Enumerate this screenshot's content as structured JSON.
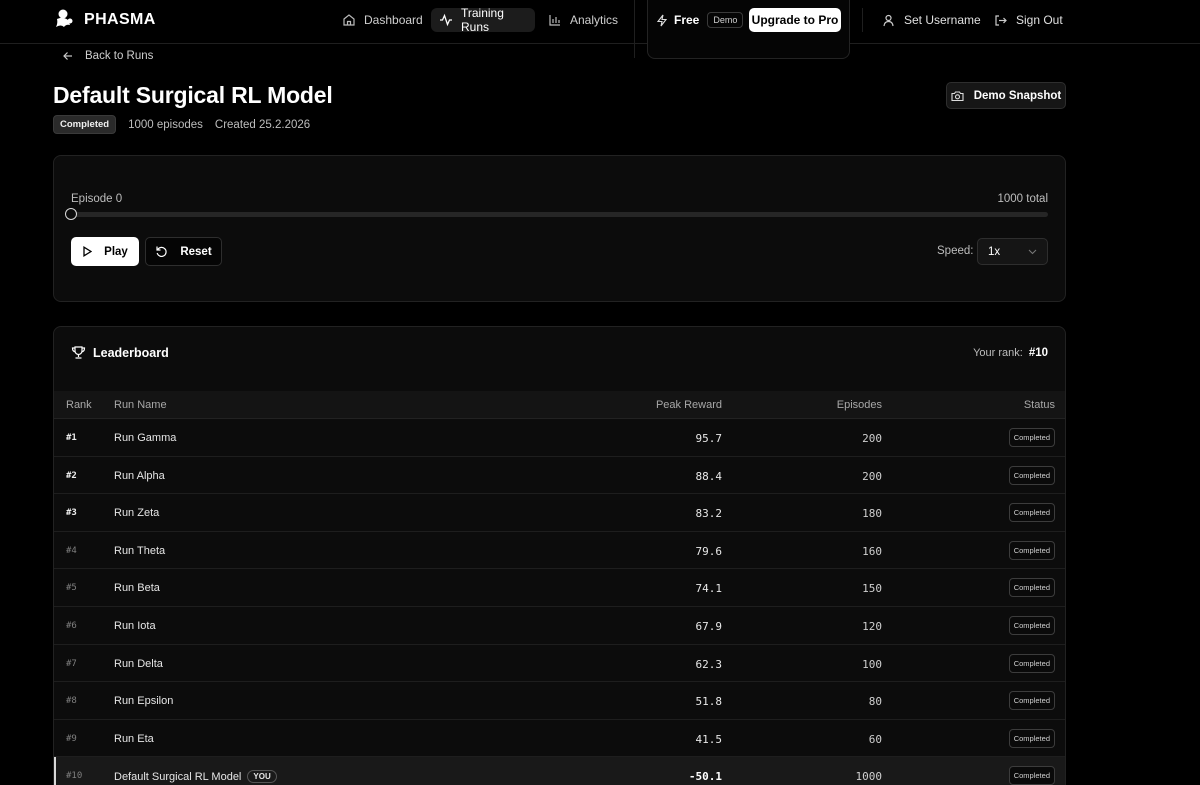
{
  "nav": {
    "brand": "PHASMA",
    "links": [
      {
        "label": "Dashboard",
        "icon": "home-icon"
      },
      {
        "label": "Training Runs",
        "icon": "activity-icon"
      },
      {
        "label": "Analytics",
        "icon": "bar-chart-icon"
      }
    ],
    "plan": {
      "name": "Free",
      "badge": "Demo",
      "icon": "bolt-icon"
    },
    "upgrade_label": "Upgrade to Pro",
    "set_username_label": "Set Username",
    "sign_out_label": "Sign Out"
  },
  "header": {
    "back_label": "Back to Runs",
    "title": "Default Surgical RL Model",
    "status": "Completed",
    "episodes": "1000 episodes",
    "created": "Created 25.2.2026",
    "snapshot_label": "Demo Snapshot"
  },
  "playback": {
    "episode_label": "Episode 0",
    "total_label": "1000 total",
    "progress": 0,
    "play_label": "Play",
    "reset_label": "Reset",
    "speed_label": "Speed:",
    "speed_value": "1x"
  },
  "leaderboard": {
    "title": "Leaderboard",
    "your_rank_label": "Your rank:",
    "your_rank_value": "#10",
    "columns": {
      "rank": "Rank",
      "name": "Run Name",
      "reward": "Peak Reward",
      "episodes": "Episodes",
      "status": "Status"
    },
    "rows": [
      {
        "rank": "#1",
        "name": "Run Gamma",
        "reward": "95.7",
        "episodes": "200",
        "status": "Completed"
      },
      {
        "rank": "#2",
        "name": "Run Alpha",
        "reward": "88.4",
        "episodes": "200",
        "status": "Completed"
      },
      {
        "rank": "#3",
        "name": "Run Zeta",
        "reward": "83.2",
        "episodes": "180",
        "status": "Completed"
      },
      {
        "rank": "#4",
        "name": "Run Theta",
        "reward": "79.6",
        "episodes": "160",
        "status": "Completed"
      },
      {
        "rank": "#5",
        "name": "Run Beta",
        "reward": "74.1",
        "episodes": "150",
        "status": "Completed"
      },
      {
        "rank": "#6",
        "name": "Run Iota",
        "reward": "67.9",
        "episodes": "120",
        "status": "Completed"
      },
      {
        "rank": "#7",
        "name": "Run Delta",
        "reward": "62.3",
        "episodes": "100",
        "status": "Completed"
      },
      {
        "rank": "#8",
        "name": "Run Epsilon",
        "reward": "51.8",
        "episodes": "80",
        "status": "Completed"
      },
      {
        "rank": "#9",
        "name": "Run Eta",
        "reward": "41.5",
        "episodes": "60",
        "status": "Completed"
      },
      {
        "rank": "#10",
        "name": "Default Surgical RL Model",
        "reward": "-50.1",
        "episodes": "1000",
        "status": "Completed",
        "you_badge": "YOU"
      }
    ]
  }
}
